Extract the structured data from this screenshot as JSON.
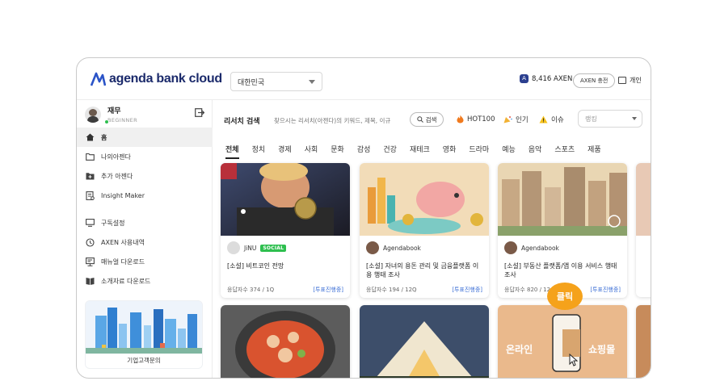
{
  "header": {
    "logo_text_1": "agenda",
    "logo_text_2": "bank cloud",
    "country": "대한민국",
    "axen_balance": "8,416 AXEN",
    "axen_charge": "AXEN 충전",
    "personal": "개인"
  },
  "profile": {
    "name": "재무",
    "level": "BEGINNER"
  },
  "sidebar": {
    "items": [
      {
        "label": "홈",
        "icon": "home-icon",
        "active": true
      },
      {
        "label": "나의아젠다",
        "icon": "folder-icon"
      },
      {
        "label": "추가 아젠다",
        "icon": "folder-add-icon"
      },
      {
        "label": "Insight Maker",
        "icon": "document-icon"
      }
    ],
    "items2": [
      {
        "label": "구독설정",
        "icon": "monitor-icon"
      },
      {
        "label": "AXEN 사용내역",
        "icon": "history-icon"
      },
      {
        "label": "매뉴얼 다운로드",
        "icon": "manual-icon"
      },
      {
        "label": "소개자료 다운로드",
        "icon": "book-icon"
      }
    ],
    "banner_label": "기업고객문의"
  },
  "search": {
    "title": "리서치 검색",
    "placeholder": "찾으시는 리서치(아젠다)의 키워드, 제목, 이규",
    "button": "검색",
    "hot": "HOT100",
    "popular": "인기",
    "issue": "이슈",
    "rank_placeholder": "랭킹"
  },
  "tabs": [
    "전체",
    "정치",
    "경제",
    "사회",
    "문화",
    "감성",
    "건강",
    "재테크",
    "영화",
    "드라마",
    "예능",
    "음악",
    "스포츠",
    "제품"
  ],
  "cards": [
    {
      "author": "JiNU",
      "badge": "SOCIAL",
      "title": "[소설] 비트코인 전망",
      "responses": "응답자수 374 / 1Q",
      "status": "[투표진행중]"
    },
    {
      "author": "Agendabook",
      "badge": "",
      "title": "[소설] 자녀의 용돈 관리 및 금융플랫폼 이용 행태 조사",
      "responses": "응답자수 194 / 12Q",
      "status": "[투표진행중]"
    },
    {
      "author": "Agendabook",
      "badge": "",
      "title": "[소설] 부동산 플랫폼/앱 이용 서비스 행태 조사",
      "responses": "응답자수 820 / 12",
      "status": "[투표진행중]"
    }
  ],
  "bottom_cards": [
    {
      "overlay_left": "온라인",
      "overlay_right": "쇼핑몰"
    }
  ],
  "click_bubble": "클릭"
}
